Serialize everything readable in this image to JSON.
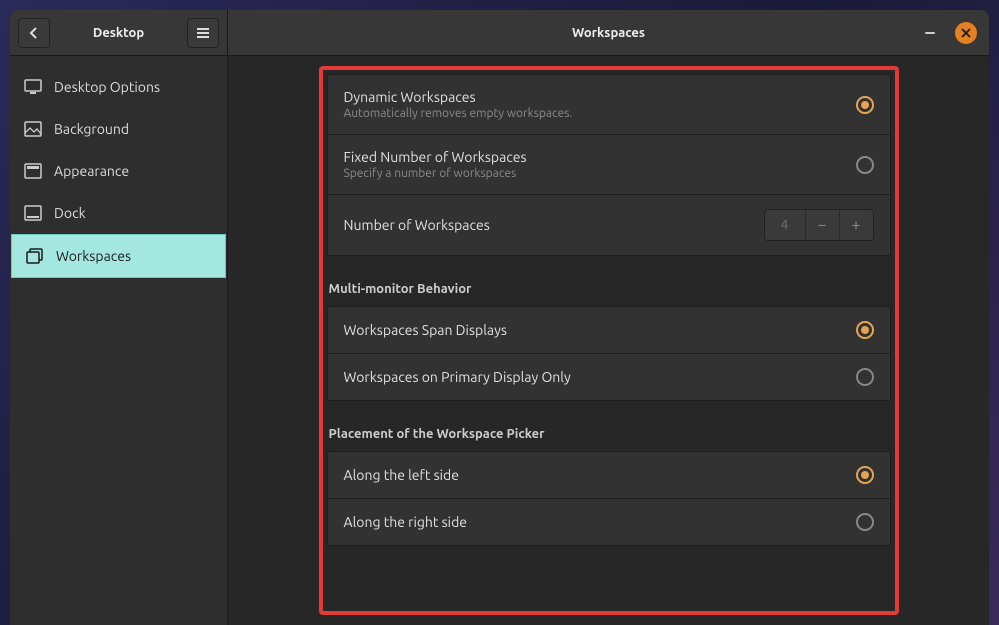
{
  "header": {
    "sidebar_title": "Desktop",
    "page_title": "Workspaces"
  },
  "sidebar": {
    "items": [
      {
        "label": "Desktop Options"
      },
      {
        "label": "Background"
      },
      {
        "label": "Appearance"
      },
      {
        "label": "Dock"
      },
      {
        "label": "Workspaces"
      }
    ]
  },
  "workspaces": {
    "dynamic": {
      "title": "Dynamic Workspaces",
      "subtitle": "Automatically removes empty workspaces."
    },
    "fixed": {
      "title": "Fixed Number of Workspaces",
      "subtitle": "Specify a number of workspaces"
    },
    "number": {
      "title": "Number of Workspaces",
      "value": "4",
      "minus": "−",
      "plus": "+"
    }
  },
  "multi": {
    "section_title": "Multi-monitor Behavior",
    "span": {
      "title": "Workspaces Span Displays"
    },
    "primary": {
      "title": "Workspaces on Primary Display Only"
    }
  },
  "placement": {
    "section_title": "Placement of the Workspace Picker",
    "left": {
      "title": "Along the left side"
    },
    "right": {
      "title": "Along the right side"
    }
  }
}
